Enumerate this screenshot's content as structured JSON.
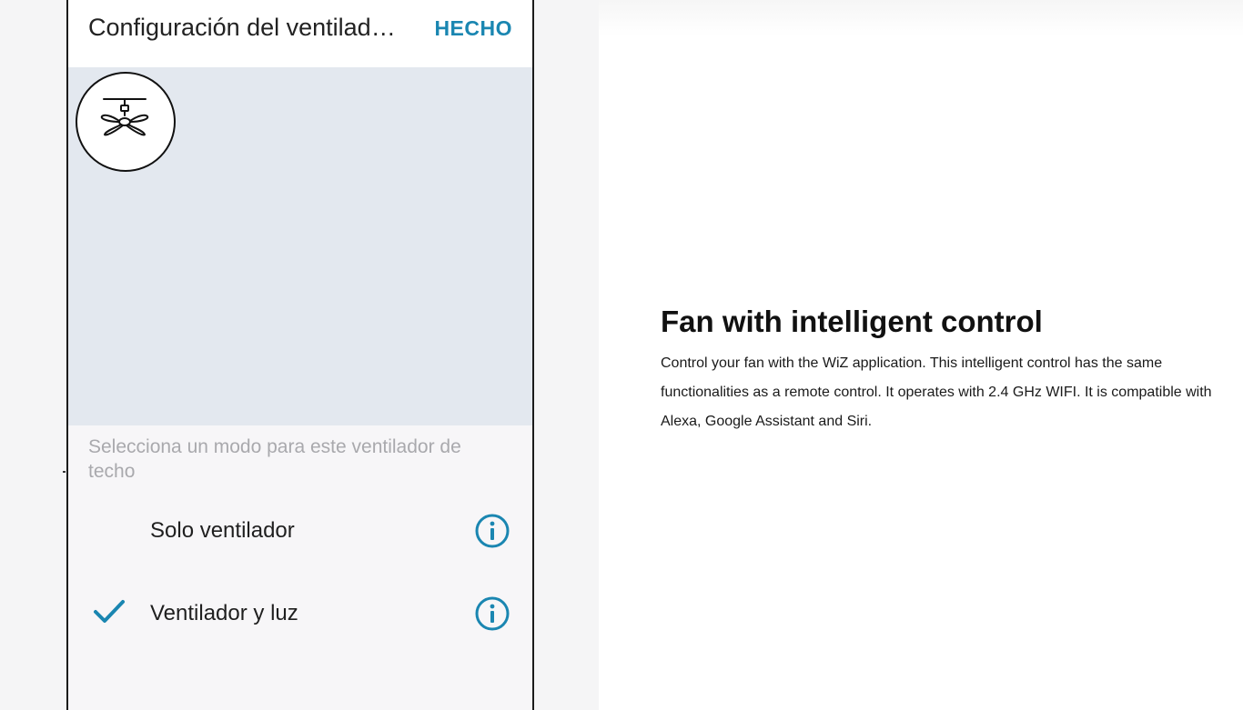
{
  "app": {
    "title": "Configuración del ventilad…",
    "done_label": "HECHO",
    "fan_icon": "ceiling-fan-icon",
    "mode_prompt": "Selecciona un modo para este ventilador de techo",
    "modes": [
      {
        "label": "Solo ventilador",
        "selected": false,
        "info_icon": "info-icon"
      },
      {
        "label": "Ventilador y luz",
        "selected": true,
        "check_icon": "checkmark-icon",
        "info_icon": "info-icon"
      }
    ],
    "colors": {
      "accent": "#1a86b1",
      "preview_bg": "#e3e8ef",
      "prompt_text": "#a9a9ad"
    }
  },
  "promo": {
    "title": "Fan with intelligent control",
    "body": "Control your fan with the WiZ application. This intelligent control has the same functionalities as a remote control. It operates with 2.4 GHz WIFI. It is compatible with Alexa, Google Assistant and Siri."
  }
}
